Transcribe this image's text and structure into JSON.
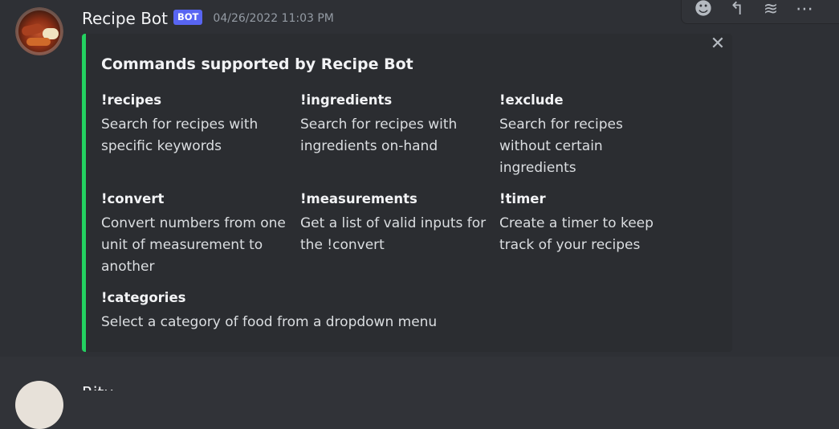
{
  "message": {
    "username": "Recipe Bot",
    "bot_tag": "BOT",
    "timestamp": "04/26/2022 11:03 PM",
    "avatar_icon": "food-plate-avatar"
  },
  "toolbar": {
    "buttons": [
      {
        "icon": "emoji-icon",
        "glyph": "☻"
      },
      {
        "icon": "reply-icon",
        "glyph": "↰"
      },
      {
        "icon": "thread-icon",
        "glyph": "≋"
      },
      {
        "icon": "more-icon",
        "glyph": "⋯"
      }
    ]
  },
  "embed": {
    "accent_color": "#23d160",
    "close_glyph": "✕",
    "title": "Commands supported by Recipe Bot",
    "fields": [
      {
        "name": "!recipes",
        "value": "Search for recipes with specific keywords"
      },
      {
        "name": "!ingredients",
        "value": "Search for recipes with ingredients on-hand"
      },
      {
        "name": "!exclude",
        "value": "Search for recipes without certain ingredients"
      },
      {
        "name": "!convert",
        "value": "Convert numbers from one unit of measurement to another"
      },
      {
        "name": "!measurements",
        "value": "Get a list of valid inputs for the !convert"
      },
      {
        "name": "!timer",
        "value": "Create a timer to keep track of your recipes"
      },
      {
        "name": "!categories",
        "value": "Select a category of food from a dropdown menu"
      }
    ]
  },
  "next_message": {
    "username": "Ritu"
  }
}
